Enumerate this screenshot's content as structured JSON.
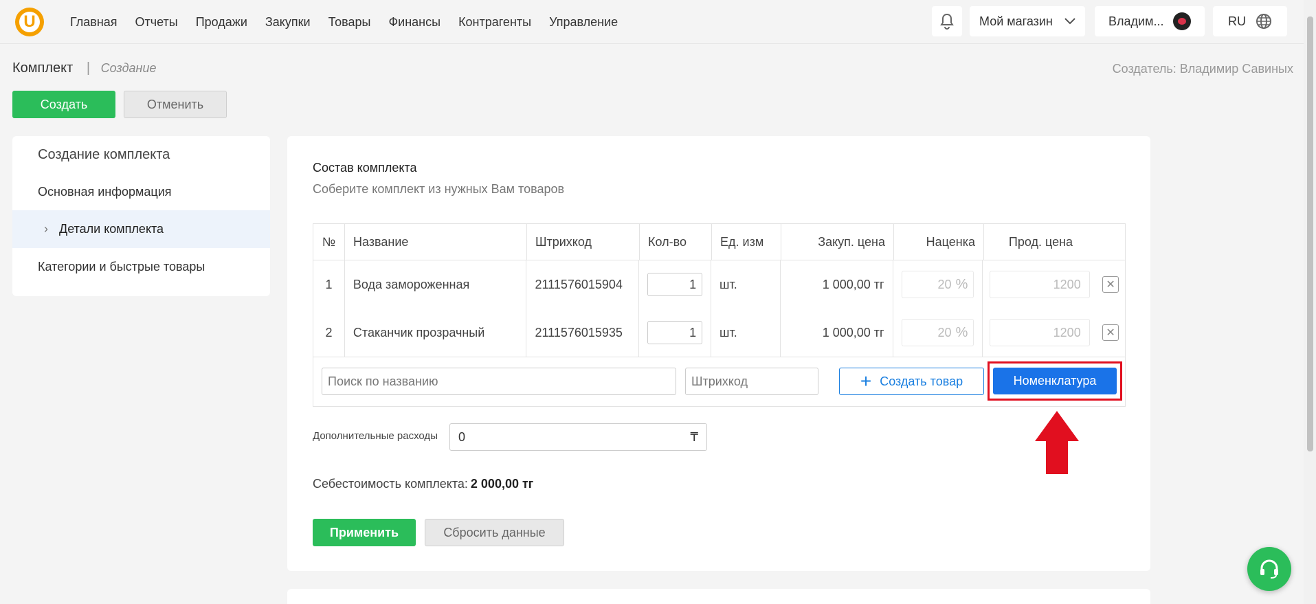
{
  "brand": {
    "logo_letter": "U",
    "accent": "#2bbd5a",
    "primary": "#1a73e8",
    "highlight": "#e10f1f"
  },
  "nav": [
    "Главная",
    "Отчеты",
    "Продажи",
    "Закупки",
    "Товары",
    "Финансы",
    "Контрагенты",
    "Управление"
  ],
  "header": {
    "store": "Мой магазин",
    "user": "Владим...",
    "lang": "RU"
  },
  "page": {
    "title": "Комплект",
    "sep": "|",
    "mode": "Создание",
    "creator": "Создатель: Владимир Савиных"
  },
  "actions": {
    "create": "Создать",
    "cancel": "Отменить"
  },
  "sidebar": {
    "title": "Создание комплекта",
    "items": [
      {
        "label": "Основная информация",
        "active": false
      },
      {
        "label": "Детали комплекта",
        "active": true
      },
      {
        "label": "Категории и быстрые товары",
        "active": false
      }
    ]
  },
  "section": {
    "title": "Состав комплекта",
    "subtitle": "Соберите комплект из нужных Вам товаров"
  },
  "table": {
    "headers": [
      "№",
      "Название",
      "Штрихкод",
      "Кол-во",
      "Ед. изм",
      "Закуп. цена",
      "Наценка",
      "Прод. цена"
    ],
    "rows": [
      {
        "n": "1",
        "name": "Вода замороженная",
        "barcode": "2111576015904",
        "qty": "1",
        "unit": "шт.",
        "cost": "1 000,00 тг",
        "markup": "20",
        "pct": "%",
        "price": "1200"
      },
      {
        "n": "2",
        "name": "Стаканчик прозрачный",
        "barcode": "2111576015935",
        "qty": "1",
        "unit": "шт.",
        "cost": "1 000,00 тг",
        "markup": "20",
        "pct": "%",
        "price": "1200"
      }
    ]
  },
  "footer": {
    "search_placeholder": "Поиск по названию",
    "barcode_placeholder": "Штрихкод",
    "create_product": "Создать товар",
    "nomenclature": "Номенклатура"
  },
  "extra": {
    "label": "Дополнительные расходы",
    "value": "0",
    "currency": "₸"
  },
  "cost": {
    "label": "Себестоимость комплекта:",
    "value": "2 000,00 тг"
  },
  "bottom": {
    "apply": "Применить",
    "reset": "Сбросить данные"
  }
}
